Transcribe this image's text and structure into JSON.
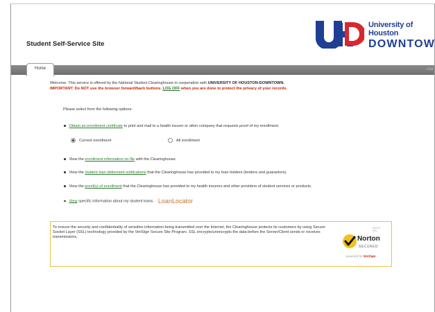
{
  "header": {
    "site_title": "Student Self-Service Site",
    "logo": {
      "line1": "University of Houston",
      "line2": "DOWNTOWN",
      "mark": "UHD",
      "brand_color": "#1f3f94",
      "accent_color": "#d8272e"
    }
  },
  "nav": {
    "home_tab": "Home",
    "right_text": "« Lo"
  },
  "intro": {
    "welcome_prefix": "Welcome. This service is offered by the National Student Clearinghouse in cooperation with ",
    "welcome_institution": "UNIVERSITY OF HOUSTON-DOWNTOWN.",
    "important_prefix": "IMPORTANT: Do NOT use the browser forward/back buttons. ",
    "logoff_link": "LOG OFF",
    "important_suffix": " when you are done to protect the privacy of your records."
  },
  "prompt": "Please select from the following options:",
  "options": {
    "cert_link": "Obtain an enrollment certificate",
    "cert_suffix": " to print and mail to a health insurer or other company that requests proof of my enrollment.",
    "radio_current": "Current enrollment",
    "radio_all": "All enrollment",
    "enroll_prefix": "View the ",
    "enroll_link": "enrollment information on file",
    "enroll_suffix": " with the Clearinghouse.",
    "deferment_prefix": "View the ",
    "deferment_link": "student loan deferment notifications",
    "deferment_suffix": " that the Clearinghouse has provided to my loan holders (lenders and guarantors).",
    "proof_prefix": "View the ",
    "proof_link": "proof(s) of enrollment",
    "proof_suffix": " that the Clearinghouse has provided to my health insurers and other providers of student services or products.",
    "view_link": "View",
    "view_suffix": " specific information about my student loans.",
    "loanlocator": "LoanLocator"
  },
  "security": {
    "text": "To ensure the security and confidentiality of sensitive information being transmitted over the Internet, the Clearinghouse protects its customers by using Secure Socket Layer (SSL) technology provided by the VeriSign Secure Site Program. SSL encrypts/unencrypts the data before the Server/Client sends or receives transmissions.",
    "norton_word": "Norton",
    "norton_secured": "SECURED",
    "powered_prefix": "powered by ",
    "powered_brand": "VeriSign",
    "badge_top": "ABOUT SSL"
  },
  "icons": {
    "norton_check": "norton-check-icon",
    "radio_current_state": "checked",
    "radio_all_state": "unchecked"
  }
}
